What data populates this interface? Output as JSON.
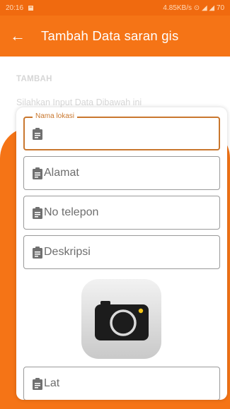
{
  "status": {
    "time": "20:16",
    "right_text": "4.85KB/s ⊙ ◢ ◢ 70"
  },
  "app_bar": {
    "title": "Tambah Data saran gis"
  },
  "intro": {
    "heading": "TAMBAH",
    "subtitle": "Silahkan Input Data Dibawah ini"
  },
  "form": {
    "fields": [
      {
        "label": "Nama lokasi",
        "value": ""
      },
      {
        "placeholder": "Alamat"
      },
      {
        "placeholder": "No telepon"
      },
      {
        "placeholder": "Deskripsi"
      },
      {
        "placeholder": "Lat"
      }
    ]
  },
  "icons": {
    "back": "arrow-left-icon",
    "field": "clipboard-icon",
    "camera": "camera-icon"
  },
  "colors": {
    "primary": "#f57416",
    "focus": "#c9772e"
  }
}
